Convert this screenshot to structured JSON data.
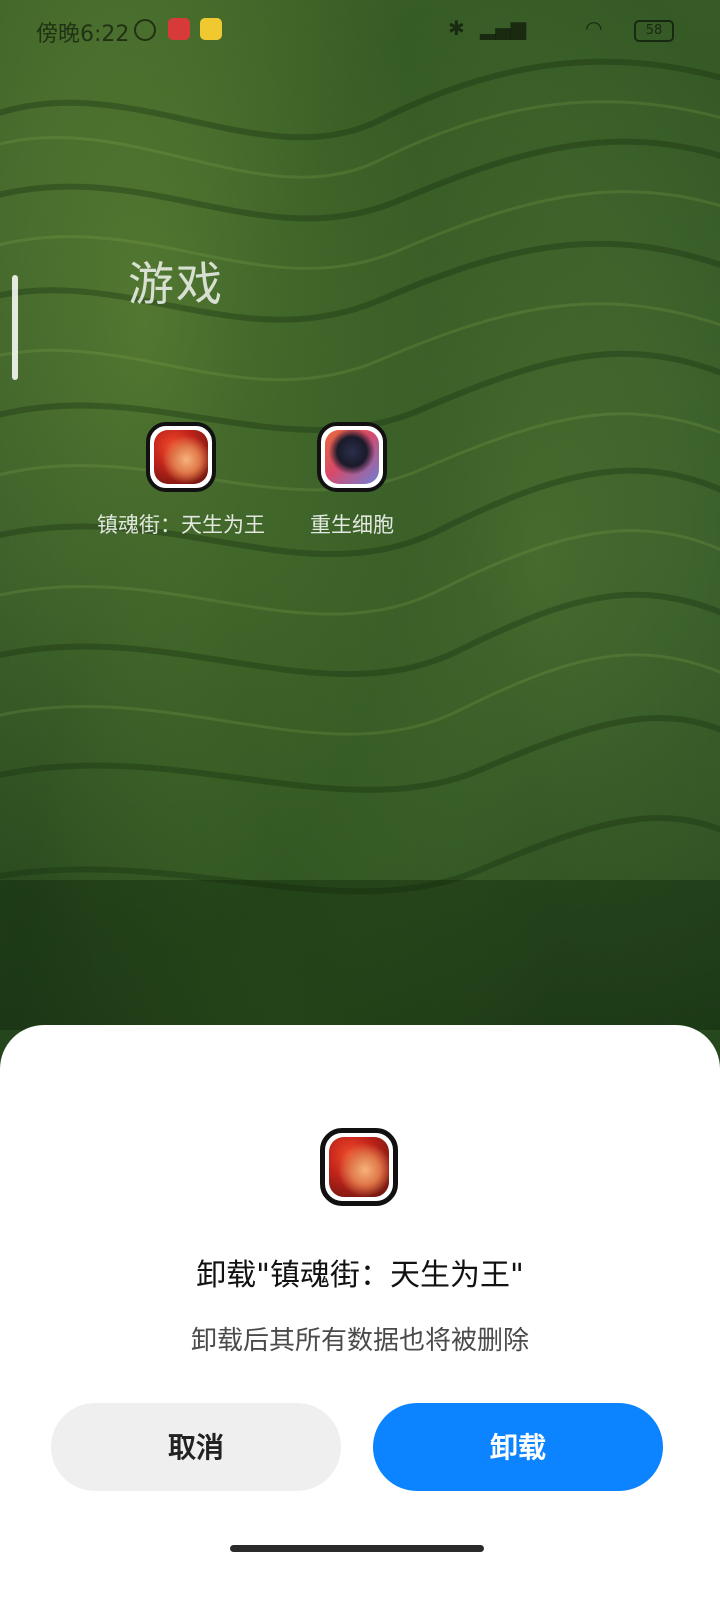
{
  "status_bar": {
    "time": "傍晚6:22",
    "battery": "58",
    "icons": [
      "alarm-icon",
      "app-notification-icon",
      "app-notification-icon-2",
      "bluetooth-icon",
      "signal-icon",
      "wifi-icon",
      "battery-icon"
    ]
  },
  "folder": {
    "title": "游戏",
    "apps": [
      {
        "label": "镇魂街：天生为王",
        "icon": "zhenhunjie-app-icon"
      },
      {
        "label": "重生细胞",
        "icon": "dead-cells-app-icon"
      }
    ]
  },
  "dialog": {
    "title": "卸载\"镇魂街：天生为王\"",
    "message": "卸载后其所有数据也将被删除",
    "cancel_label": "取消",
    "confirm_label": "卸载",
    "accent_color": "#0d84ff"
  }
}
